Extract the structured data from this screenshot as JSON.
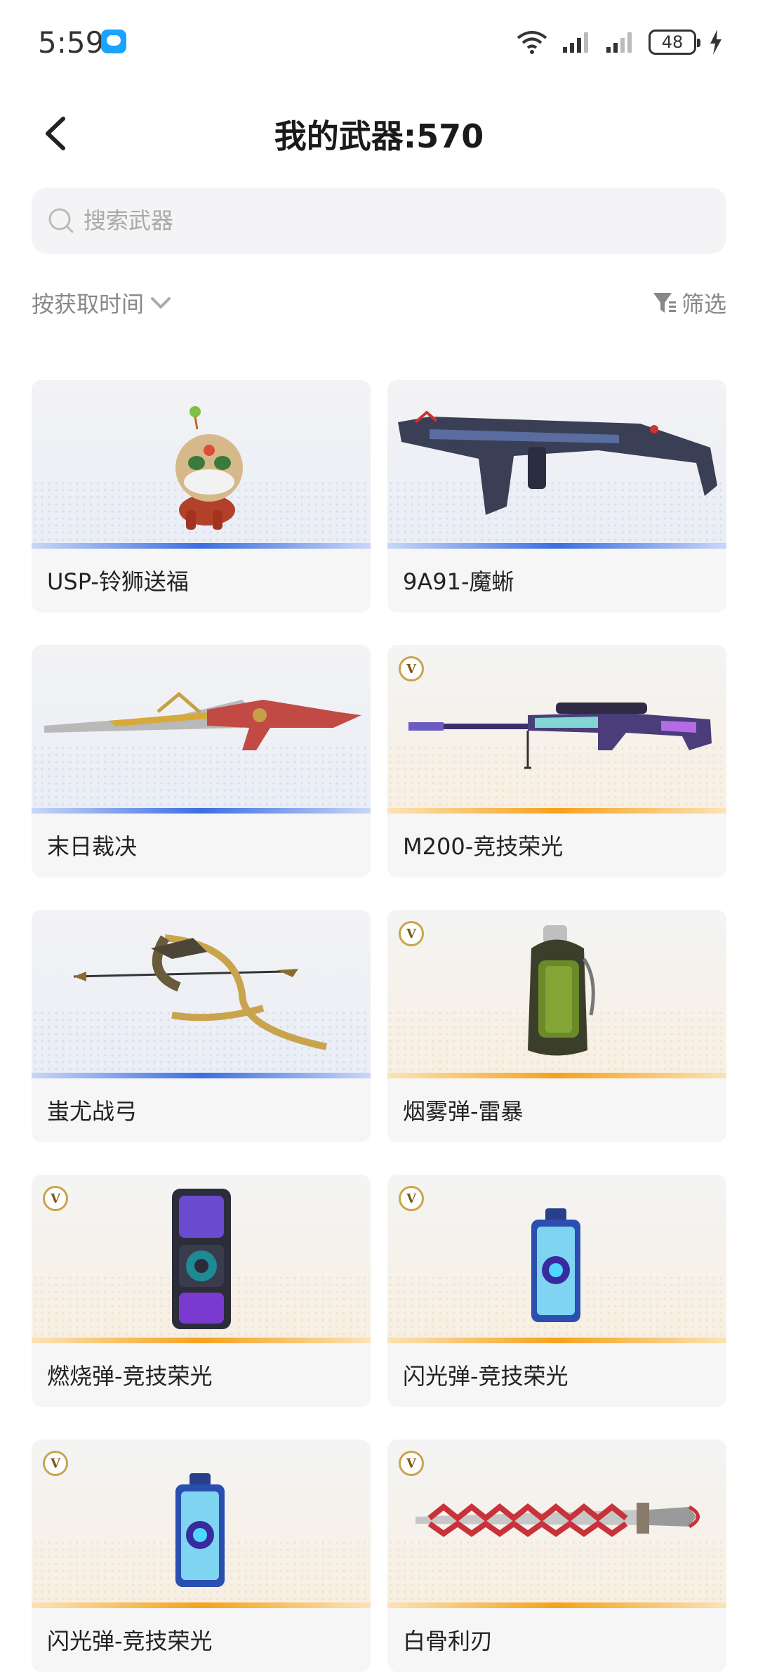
{
  "status": {
    "time": "5:59",
    "battery": "48"
  },
  "header": {
    "title": "我的武器:570"
  },
  "search": {
    "placeholder": "搜索武器"
  },
  "sort": {
    "label": "按获取时间",
    "filter_label": "筛选"
  },
  "weapons": [
    {
      "name": "USP-铃狮送福",
      "rarity": "blue",
      "icon": "lion-mascot",
      "badge": ""
    },
    {
      "name": "9A91-魔蜥",
      "rarity": "blue",
      "icon": "rifle",
      "badge": ""
    },
    {
      "name": "末日裁决",
      "rarity": "blue",
      "icon": "blade-gun",
      "badge": ""
    },
    {
      "name": "M200-竞技荣光",
      "rarity": "gold",
      "icon": "sniper-rifle",
      "badge": "V"
    },
    {
      "name": "蚩尤战弓",
      "rarity": "blue",
      "icon": "bow",
      "badge": ""
    },
    {
      "name": "烟雾弹-雷暴",
      "rarity": "gold",
      "icon": "smoke-grenade",
      "badge": "V"
    },
    {
      "name": "燃烧弹-竞技荣光",
      "rarity": "gold",
      "icon": "incendiary-grenade",
      "badge": "V"
    },
    {
      "name": "闪光弹-竞技荣光",
      "rarity": "gold",
      "icon": "flash-grenade",
      "badge": "V"
    },
    {
      "name": "闪光弹-竞技荣光",
      "rarity": "gold",
      "icon": "flash-grenade",
      "badge": "V"
    },
    {
      "name": "白骨利刃",
      "rarity": "gold",
      "icon": "bone-blade",
      "badge": "V"
    }
  ],
  "colors": {
    "blue_accent": "#3b6fe0",
    "gold_accent": "#f5a21c"
  }
}
